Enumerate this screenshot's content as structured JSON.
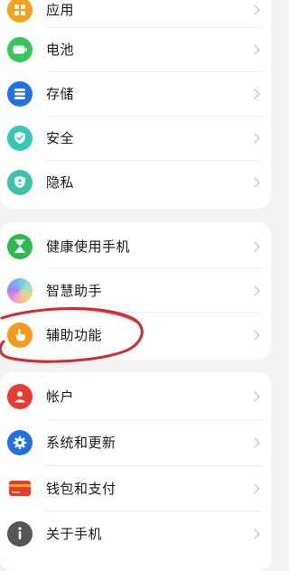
{
  "settings": {
    "items": [
      {
        "label": "应用",
        "icon": "apps-icon",
        "color": "#f5a11c"
      },
      {
        "label": "电池",
        "icon": "battery-icon",
        "color": "#34c759"
      },
      {
        "label": "存储",
        "icon": "storage-icon",
        "color": "#1f6fe5"
      },
      {
        "label": "安全",
        "icon": "security-shield-icon",
        "color": "#33c7b4"
      },
      {
        "label": "隐私",
        "icon": "privacy-shield-icon",
        "color": "#3cc3a9"
      },
      {
        "label": "健康使用手机",
        "icon": "hourglass-icon",
        "color": "#2fb84f"
      },
      {
        "label": "智慧助手",
        "icon": "assistant-orb-icon",
        "color": "#b47cf0"
      },
      {
        "label": "辅助功能",
        "icon": "hand-icon",
        "color": "#f39a1c"
      },
      {
        "label": "帐户",
        "icon": "account-icon",
        "color": "#ea3b2f"
      },
      {
        "label": "系统和更新",
        "icon": "gear-icon",
        "color": "#1f6fe5"
      },
      {
        "label": "钱包和支付",
        "icon": "wallet-icon",
        "color": "#e53b30"
      },
      {
        "label": "关于手机",
        "icon": "info-icon",
        "color": "#555555"
      }
    ]
  },
  "annotation": {
    "color": "#d42a30",
    "highlighted_item": "辅助功能"
  }
}
